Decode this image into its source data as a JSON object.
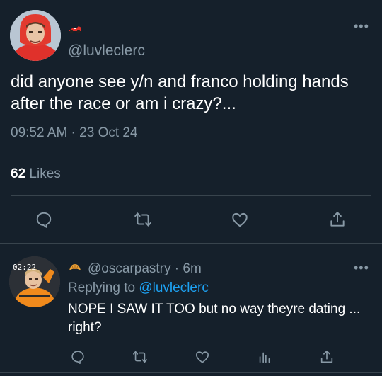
{
  "main_tweet": {
    "handle": "@luvleclerc",
    "text": "did anyone see y/n and franco holding hands after the race or am i crazy?...",
    "timestamp": "09:52 AM · 23 Oct 24",
    "likes_count": "62",
    "likes_label": " Likes",
    "more_label": "•••",
    "name_emoji": "race-car-icon"
  },
  "reply": {
    "handle": "@oscarpastry",
    "time": " · 6m",
    "replying_prefix": "Replying to ",
    "replying_to": "@luvleclerc",
    "text": "NOPE I SAW IT TOO but no way theyre dating ... right?",
    "avatar_time": "02:22",
    "more_label": "•••",
    "name_emoji": "croissant-icon"
  },
  "colors": {
    "background": "#15202b",
    "text": "#ffffff",
    "muted": "#8899a6",
    "link": "#1da1f2",
    "divider": "#38444d"
  }
}
